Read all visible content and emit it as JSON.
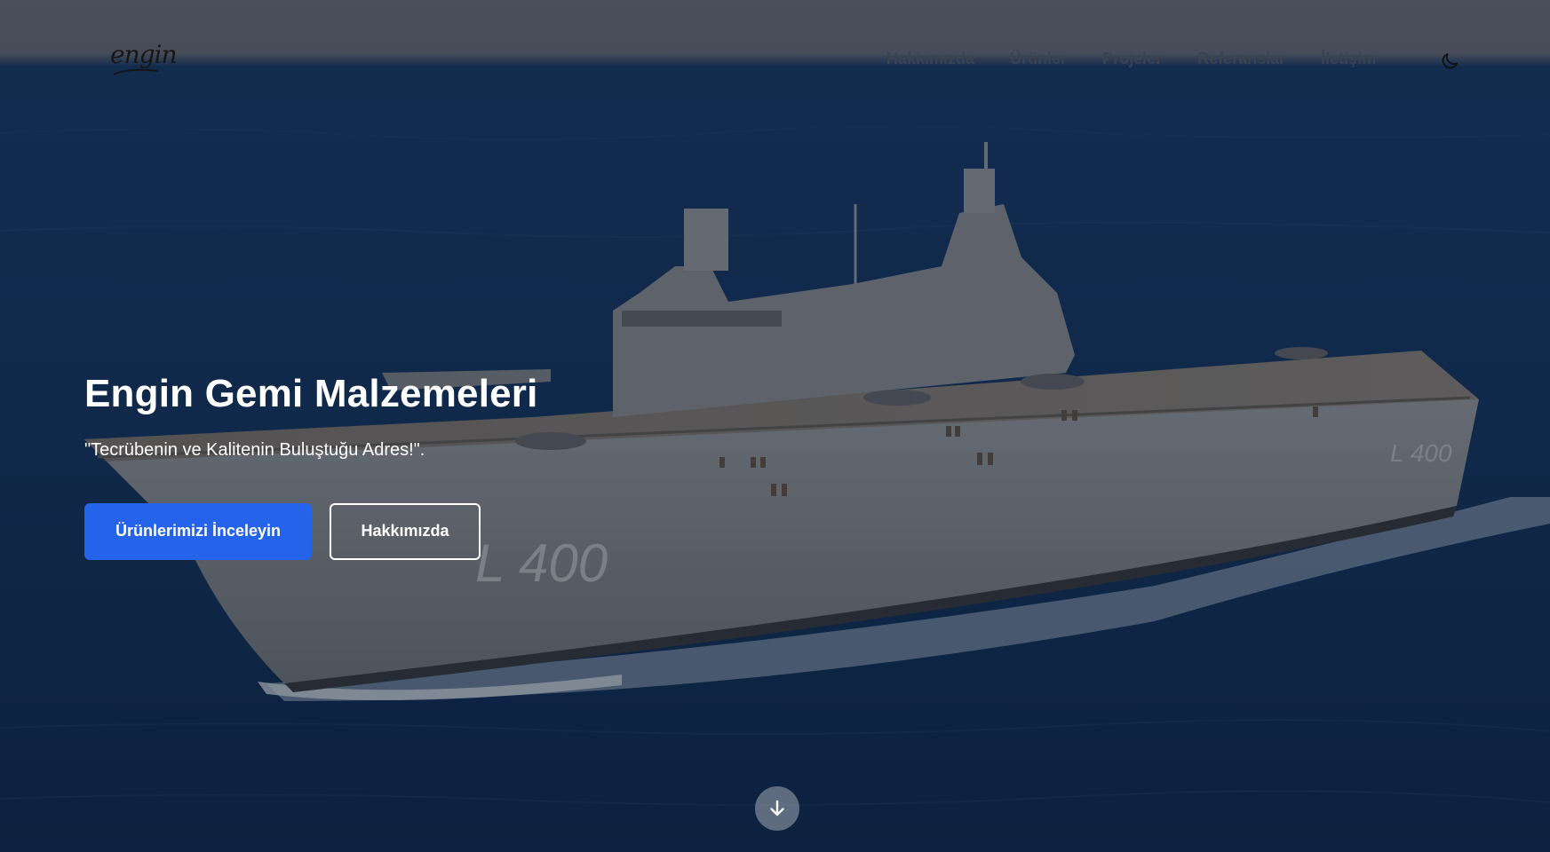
{
  "header": {
    "logo_text": "engin",
    "nav": [
      {
        "label": "Hakkımızda"
      },
      {
        "label": "Ürünler"
      },
      {
        "label": "Projeler"
      },
      {
        "label": "Referanslar"
      },
      {
        "label": "İletişim"
      }
    ],
    "theme_toggle_icon": "moon-icon"
  },
  "hero": {
    "title": "Engin Gemi Malzemeleri",
    "tagline": "\"Tecrübenin ve Kalitenin Buluştuğu Adres!\".",
    "primary_button": "Ürünlerimizi İnceleyin",
    "secondary_button": "Hakkımızda",
    "scroll_icon": "arrow-down-icon",
    "background_image": "warship-at-sea",
    "ship_hull_number": "L 400"
  },
  "colors": {
    "primary": "#2563eb",
    "sea": "#123664",
    "ship": "#8f9398",
    "header_bg": "#4a4f5b"
  }
}
